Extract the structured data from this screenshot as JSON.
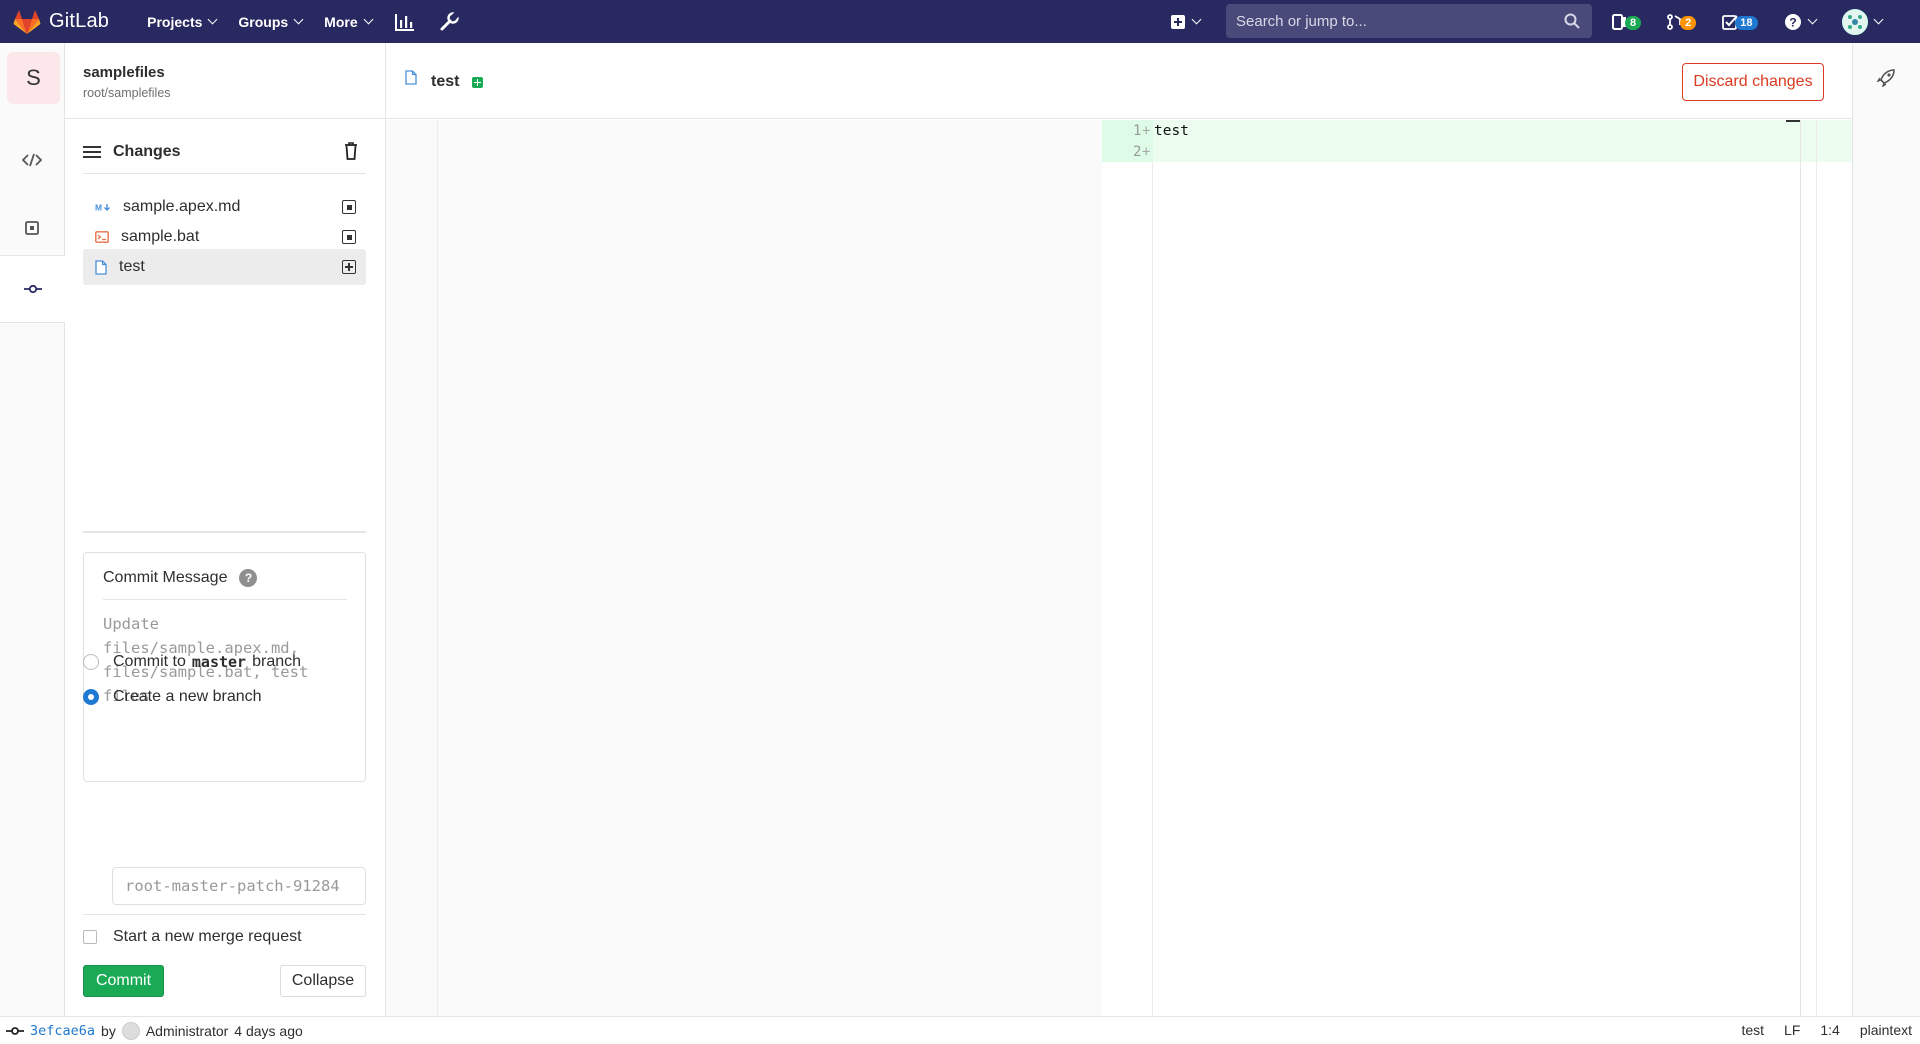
{
  "navbar": {
    "brand": "GitLab",
    "menu": [
      "Projects",
      "Groups",
      "More"
    ],
    "search_placeholder": "Search or jump to...",
    "badges": {
      "issues": "8",
      "merge_requests": "2",
      "todos": "18"
    },
    "colors": {
      "bg": "#292961",
      "green": "#1aaa55",
      "orange": "#fc9403",
      "blue": "#1f78d1"
    }
  },
  "project": {
    "avatar_letter": "S",
    "name": "samplefiles",
    "path": "root/samplefiles"
  },
  "changes": {
    "title": "Changes",
    "files": [
      {
        "name": "sample.apex.md",
        "icon": "markdown-icon"
      },
      {
        "name": "sample.bat",
        "icon": "terminal-icon"
      },
      {
        "name": "test",
        "icon": "file-icon"
      }
    ]
  },
  "commit": {
    "label": "Commit Message",
    "message_placeholder": "Update files/sample.apex.md, files/sample.bat, test files",
    "option_commit_prefix": "Commit to",
    "option_commit_branch": "master",
    "option_commit_suffix": "branch",
    "option_new_branch": "Create a new branch",
    "branch_placeholder": "root-master-patch-91284",
    "merge_request_label": "Start a new merge request",
    "commit_button": "Commit",
    "collapse_button": "Collapse"
  },
  "editor": {
    "tab_name": "test",
    "discard_button": "Discard changes",
    "lines": [
      {
        "num": "1",
        "marker": "+",
        "code": "test"
      },
      {
        "num": "2",
        "marker": "+",
        "code": ""
      }
    ]
  },
  "statusbar": {
    "sha": "3efcae6a",
    "by": "by",
    "author": "Administrator",
    "time": "4 days ago",
    "file": "test",
    "eol": "LF",
    "cursor": "1:4",
    "language": "plaintext"
  }
}
